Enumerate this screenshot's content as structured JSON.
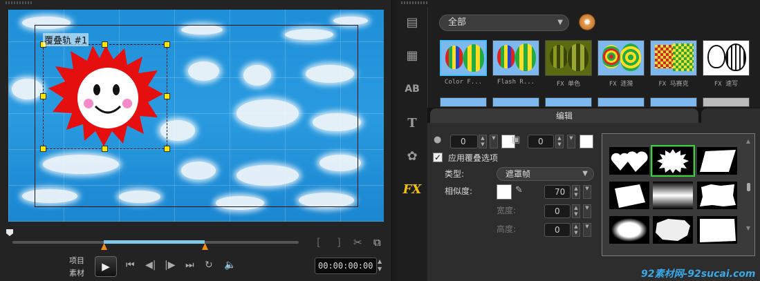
{
  "preview": {
    "overlay_label": "覆叠轨 #1"
  },
  "transport": {
    "mode_project": "项目",
    "mode_clip": "素材",
    "timecode": "00:00:00:00"
  },
  "library": {
    "category": "全部",
    "thumbnails": [
      {
        "label": "Color F..."
      },
      {
        "label": "Flash R..."
      },
      {
        "label": "FX 单色"
      },
      {
        "label": "FX 涟漪"
      },
      {
        "label": "FX 马赛克"
      },
      {
        "label": "FX 速写"
      }
    ]
  },
  "options": {
    "tab_edit": "编辑",
    "border_value": "0",
    "border_color": "#ffffff",
    "edge_value": "0",
    "edge_color": "#ffffff",
    "apply_overlay_label": "应用覆叠选项",
    "type_label": "类型:",
    "type_value": "遮罩帧",
    "similarity_label": "相似度:",
    "similarity_value": "70",
    "width_label": "宽度:",
    "width_value": "0",
    "height_label": "高度:",
    "height_value": "0"
  },
  "watermark": "92素材网-92sucai.com"
}
